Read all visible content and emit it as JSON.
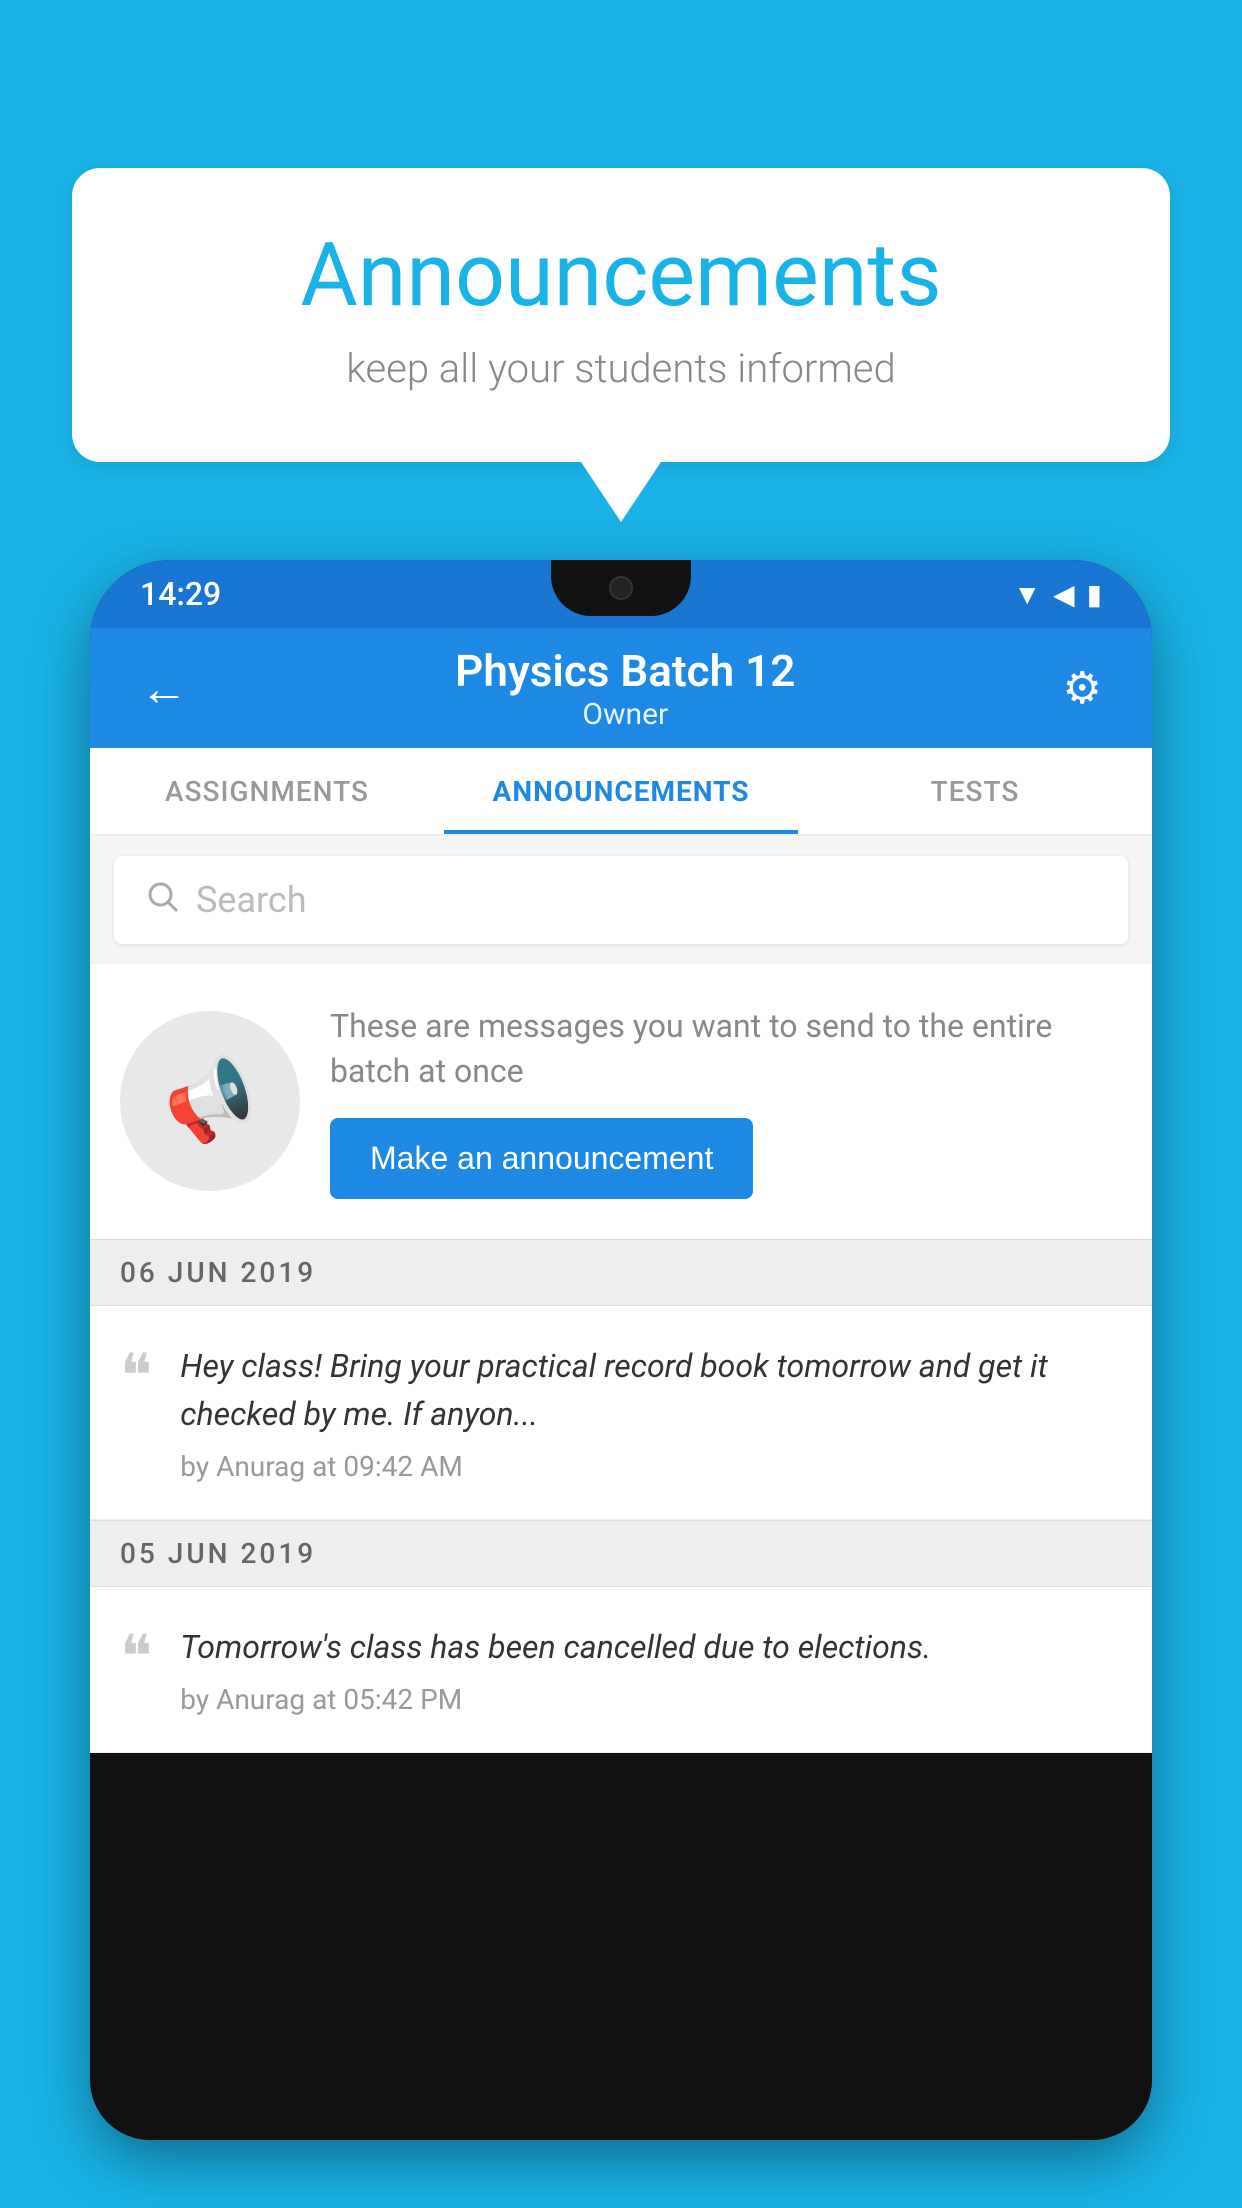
{
  "background_color": "#1ab3e8",
  "speech_bubble": {
    "title": "Announcements",
    "subtitle": "keep all your students informed"
  },
  "phone": {
    "status_bar": {
      "time": "14:29",
      "icons": [
        "wifi",
        "signal",
        "battery"
      ]
    },
    "app_bar": {
      "title": "Physics Batch 12",
      "subtitle": "Owner",
      "back_label": "←",
      "settings_label": "⚙"
    },
    "tabs": [
      {
        "label": "ASSIGNMENTS",
        "active": false
      },
      {
        "label": "ANNOUNCEMENTS",
        "active": true
      },
      {
        "label": "TESTS",
        "active": false
      }
    ],
    "search": {
      "placeholder": "Search"
    },
    "promo": {
      "text": "These are messages you want to send to the entire batch at once",
      "button_label": "Make an announcement"
    },
    "announcements": [
      {
        "date": "06  JUN  2019",
        "text": "Hey class! Bring your practical record book tomorrow and get it checked by me. If anyon...",
        "meta": "by Anurag at 09:42 AM"
      },
      {
        "date": "05  JUN  2019",
        "text": "Tomorrow's class has been cancelled due to elections.",
        "meta": "by Anurag at 05:42 PM"
      }
    ]
  }
}
